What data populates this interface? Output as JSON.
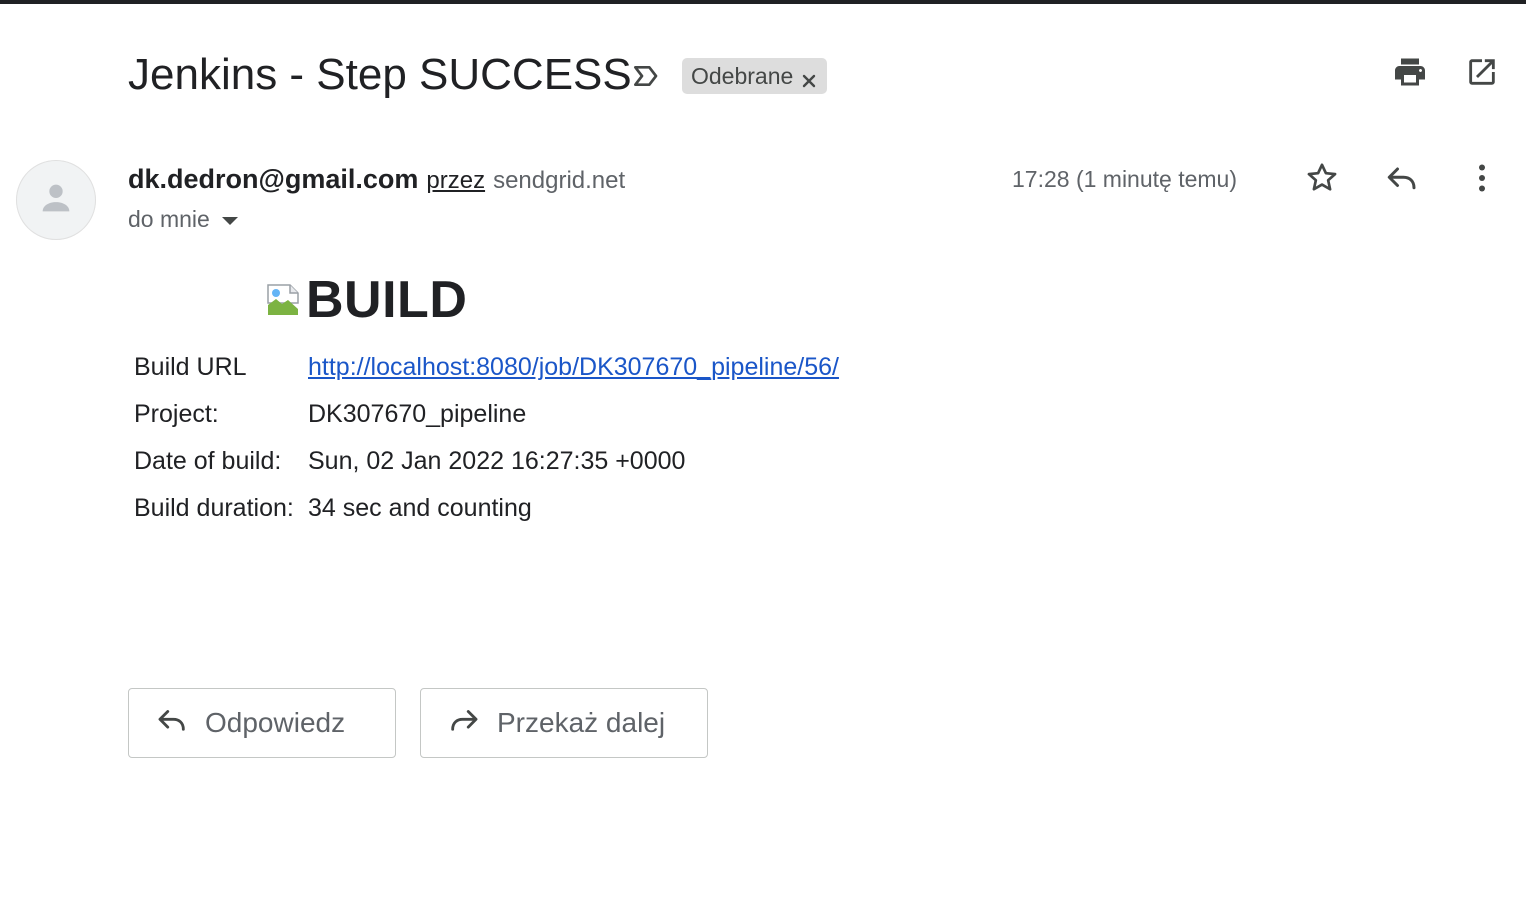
{
  "subject": "Jenkins - Step SUCCESS",
  "label_chip": "Odebrane",
  "sender": {
    "email": "dk.dedron@gmail.com",
    "via_label": "przez",
    "via_domain": "sendgrid.net",
    "to_label": "do mnie"
  },
  "timestamp": "17:28 (1 minutę temu)",
  "body": {
    "heading": "BUILD",
    "rows": [
      {
        "key": "Build URL",
        "value": "http://localhost:8080/job/DK307670_pipeline/56/"
      },
      {
        "key": "Project:",
        "value": "DK307670_pipeline"
      },
      {
        "key": "Date of build:",
        "value": "Sun, 02 Jan 2022 16:27:35 +0000"
      },
      {
        "key": "Build duration:",
        "value": "34 sec and counting"
      }
    ]
  },
  "actions": {
    "reply": "Odpowiedz",
    "forward": "Przekaż dalej"
  },
  "icons": {
    "label": "label-important-icon",
    "chip_close": "close-icon",
    "print": "print-icon",
    "popout": "open-in-new-window-icon",
    "avatar": "person-icon",
    "star": "star-icon",
    "reply": "reply-icon",
    "more": "more-vert-icon",
    "forward": "forward-icon"
  },
  "colors": {
    "link": "#1a56c8",
    "chip_bg": "#dddddd",
    "text": "#202124",
    "muted": "#5f6368"
  }
}
